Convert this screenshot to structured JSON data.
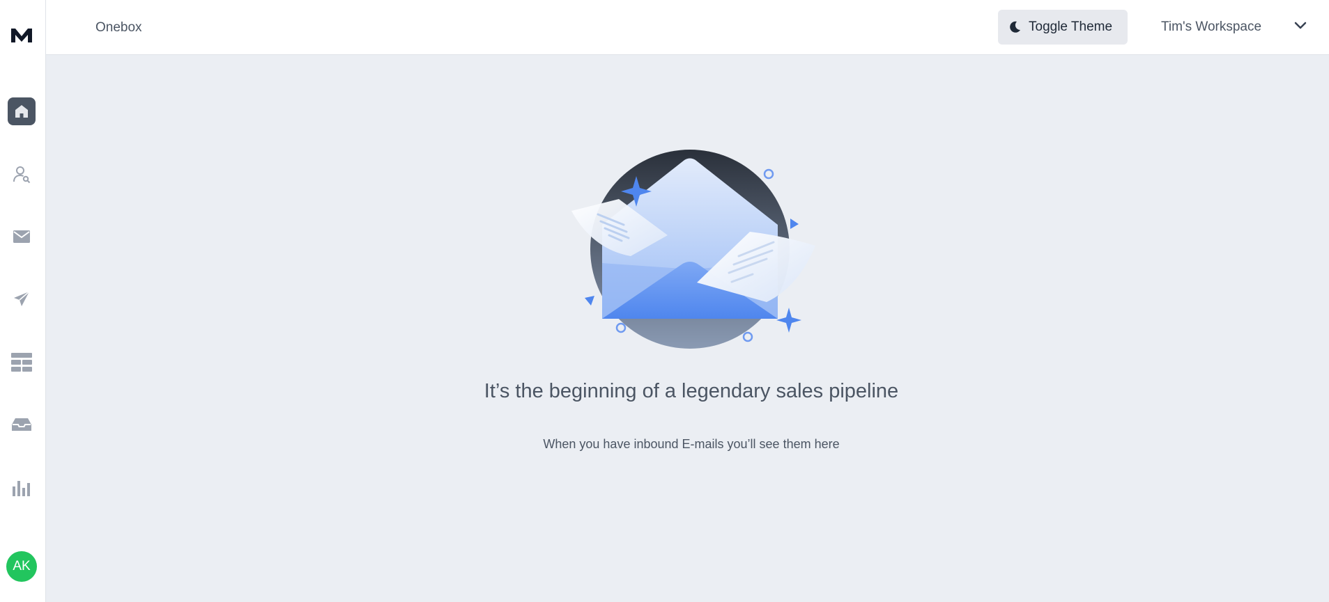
{
  "app": {
    "logo_icon": "mailreach-m-logo"
  },
  "sidebar": {
    "items": [
      {
        "name": "home",
        "icon": "home-icon",
        "active": true
      },
      {
        "name": "leads",
        "icon": "user-search-icon",
        "active": false
      },
      {
        "name": "mail",
        "icon": "envelope-icon",
        "active": false
      },
      {
        "name": "campaigns",
        "icon": "send-icon",
        "active": false
      },
      {
        "name": "templates",
        "icon": "table-icon",
        "active": false
      },
      {
        "name": "inbox",
        "icon": "inbox-tray-icon",
        "active": false
      },
      {
        "name": "analytics",
        "icon": "bar-chart-icon",
        "active": false
      }
    ],
    "avatar_initials": "AK"
  },
  "header": {
    "title": "Onebox",
    "toggle_theme_label": "Toggle Theme",
    "workspace_label": "Tim's Workspace"
  },
  "empty_state": {
    "title": "It’s the beginning of a legendary sales pipeline",
    "subtitle": "When you have inbound E-mails you’ll see them here"
  },
  "colors": {
    "accent": "#4b5563",
    "avatar_bg": "#22c55e",
    "background": "#ebeef3",
    "illustration_blue": "#5b8ff0"
  }
}
